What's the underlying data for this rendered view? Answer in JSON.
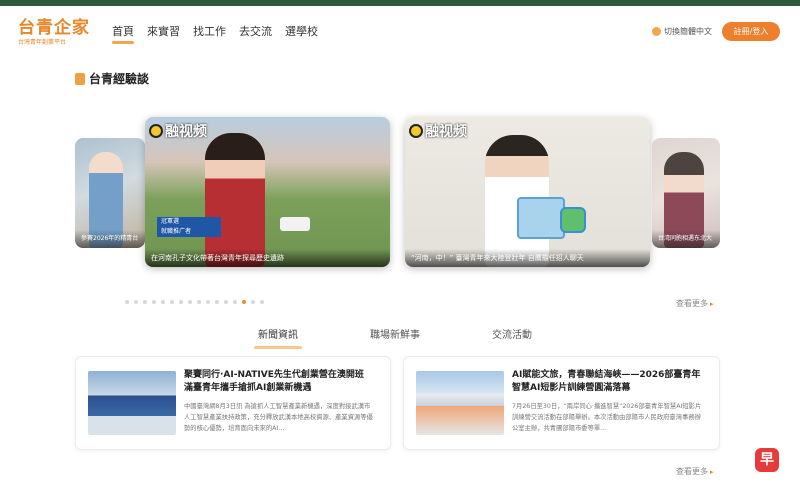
{
  "logo": {
    "main": "台青企家",
    "sub": "台灣青年創業平台"
  },
  "nav": [
    {
      "label": "首頁",
      "active": true
    },
    {
      "label": "來實習",
      "active": false
    },
    {
      "label": "找工作",
      "active": false
    },
    {
      "label": "去交流",
      "active": false
    },
    {
      "label": "選學校",
      "active": false
    }
  ],
  "header": {
    "lang_label": "切換簡體中文",
    "login_label": "註冊/登入"
  },
  "section": {
    "title": "台青經驗談"
  },
  "carousel": {
    "brand": "融视频",
    "slides": [
      {
        "caption": "參賽2026年的精青台",
        "position": "left"
      },
      {
        "caption": "在河南孔子文化帶著台灣青年探尋歷史遺跡",
        "name_tag": "冠軍選",
        "name_sub": "就職推广者",
        "position": "main-left"
      },
      {
        "caption": "“河南，中！” 臺灣青年來大陸登壯年 自薦擔任招人聊天",
        "position": "main-right"
      },
      {
        "caption": "台湾同胞相遇东北大",
        "position": "right"
      }
    ],
    "dot_count": 16,
    "active_dot": 13,
    "more_label": "查看更多"
  },
  "tabs": [
    {
      "label": "新聞資訊",
      "active": true
    },
    {
      "label": "職場新鮮事",
      "active": false
    },
    {
      "label": "交流活動",
      "active": false
    }
  ],
  "news": [
    {
      "title": "聚賽同行·AI-NATIVE先生代創業營在澳開班 滿臺青年攜手搶抓AI創業新機遇",
      "desc": "中國臺灣網8月3日訊 為搶抓人工智慧產業新機遇，深度對接武漢市人工智慧產業扶持政策，充分釋放武漢本地高校資源、產業資源等優勢的核心優勢，培育面向未來的AI..."
    },
    {
      "title": "AI賦能文旅，青春聯結海峽——2026部臺青年智慧AI短影片訓練營圓滿落幕",
      "desc": "7月26日至30日，“兩岸同心·攜進智慧”2026部臺青年智慧AI短影片訓練營交流活動在部陽舉辦。本次活動由部陽市人民政府臺灣事務辦公室主辦，共青團部陽市委等單..."
    }
  ],
  "more_bottom": "查看更多",
  "fab_label": "早"
}
